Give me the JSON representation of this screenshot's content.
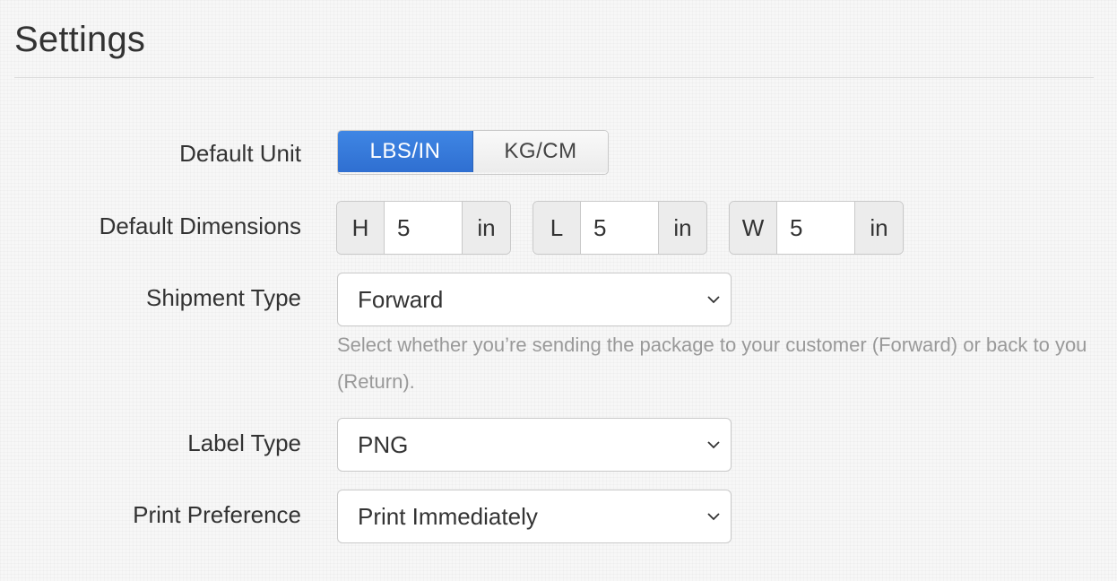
{
  "header": {
    "title": "Settings"
  },
  "settings": {
    "default_unit": {
      "label": "Default Unit",
      "options": [
        "LBS/IN",
        "KG/CM"
      ],
      "selected": "LBS/IN"
    },
    "default_dimensions": {
      "label": "Default Dimensions",
      "fields": [
        {
          "prefix": "H",
          "value": "5",
          "unit": "in"
        },
        {
          "prefix": "L",
          "value": "5",
          "unit": "in"
        },
        {
          "prefix": "W",
          "value": "5",
          "unit": "in"
        }
      ]
    },
    "shipment_type": {
      "label": "Shipment Type",
      "selected": "Forward",
      "help": "Select whether you’re sending the package to your customer (Forward) or back to you (Return)."
    },
    "label_type": {
      "label": "Label Type",
      "selected": "PNG"
    },
    "print_preference": {
      "label": "Print Preference",
      "selected": "Print Immediately"
    }
  },
  "icons": {
    "select_arrow": "chevron-down-icon"
  },
  "colors": {
    "accent": "#2f6fd1",
    "help_text": "#999999",
    "border": "#c9c9c9"
  }
}
